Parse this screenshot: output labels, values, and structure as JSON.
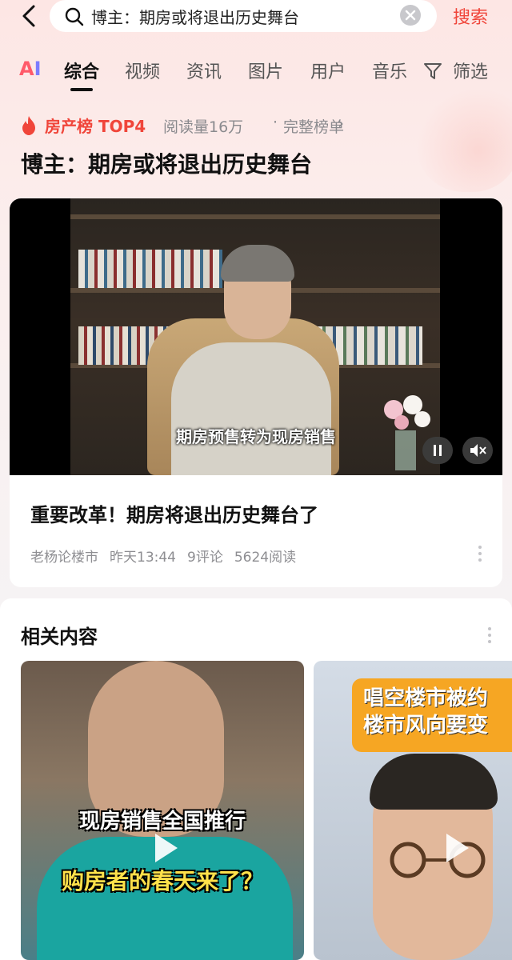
{
  "search": {
    "query": "博主：期房或将退出历史舞台",
    "submit_label": "搜索"
  },
  "tabs": {
    "ai_label_a": "A",
    "ai_label_i": "I",
    "items": [
      "综合",
      "视频",
      "资讯",
      "图片",
      "用户",
      "音乐"
    ],
    "active": "综合",
    "filter_label": "筛选"
  },
  "hot_board": {
    "title": "房产榜 TOP4",
    "reads": "阅读量16万",
    "separator": "·",
    "link": "完整榜单",
    "chevron": "›"
  },
  "page_title": "博主：期房或将退出历史舞台",
  "video_card": {
    "subtitle": "期房预售转为现房销售",
    "title": "重要改革！期房将退出历史舞台了",
    "author": "老杨论楼市",
    "time": "昨天13:44",
    "comments": "9评论",
    "reads": "5624阅读"
  },
  "related": {
    "title": "相关内容",
    "items": [
      {
        "overlay_line1": "现房销售全国推行",
        "overlay_line2": "购房者的春天来了？"
      },
      {
        "overlay_line1": "唱空楼市被约",
        "overlay_line2": "楼市风向要变"
      }
    ]
  },
  "colors": {
    "accent": "#f0453a",
    "banner": "#f6a623",
    "highlight_text": "#ffe14a"
  }
}
